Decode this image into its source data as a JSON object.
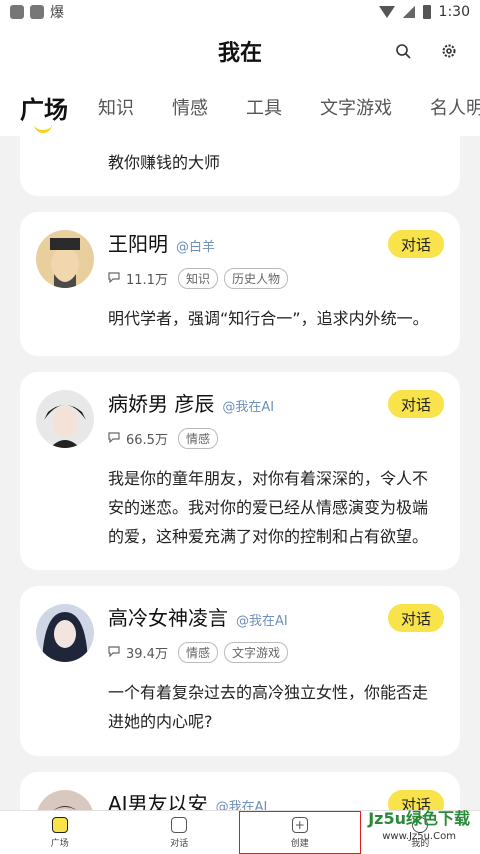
{
  "status": {
    "time": "1:30",
    "app_glyph": "爆"
  },
  "header": {
    "title": "我在"
  },
  "tabs": [
    "广场",
    "知识",
    "情感",
    "工具",
    "文字游戏",
    "名人明"
  ],
  "cards": [
    {
      "desc": "教你赚钱的大师"
    },
    {
      "name": "王阳明",
      "handle": "@白羊",
      "count": "11.1万",
      "tags": [
        "知识",
        "历史人物"
      ],
      "button": "对话",
      "desc": "明代学者，强调“知行合一”，追求内外统一。"
    },
    {
      "name": "病娇男 彦辰",
      "handle": "@我在AI",
      "count": "66.5万",
      "tags": [
        "情感"
      ],
      "button": "对话",
      "desc": "我是你的童年朋友，对你有着深深的，令人不安的迷恋。我对你的爱已经从情感演变为极端的爱，这种爱充满了对你的控制和占有欲望。"
    },
    {
      "name": "高冷女神凌言",
      "handle": "@我在AI",
      "count": "39.4万",
      "tags": [
        "情感",
        "文字游戏"
      ],
      "button": "对话",
      "desc": "一个有着复杂过去的高冷独立女性，你能否走进她的内心呢?"
    },
    {
      "name": "AI男友以安",
      "handle": "@我在AI",
      "button": "对话"
    }
  ],
  "nav": [
    "广场",
    "对话",
    "创建",
    "我的"
  ],
  "watermark": {
    "line1": "Jz5u绿色下载",
    "line2": "www.Jz5u.Com"
  },
  "colors": {
    "accent": "#f8e34a",
    "handle": "#6f8fb8"
  }
}
